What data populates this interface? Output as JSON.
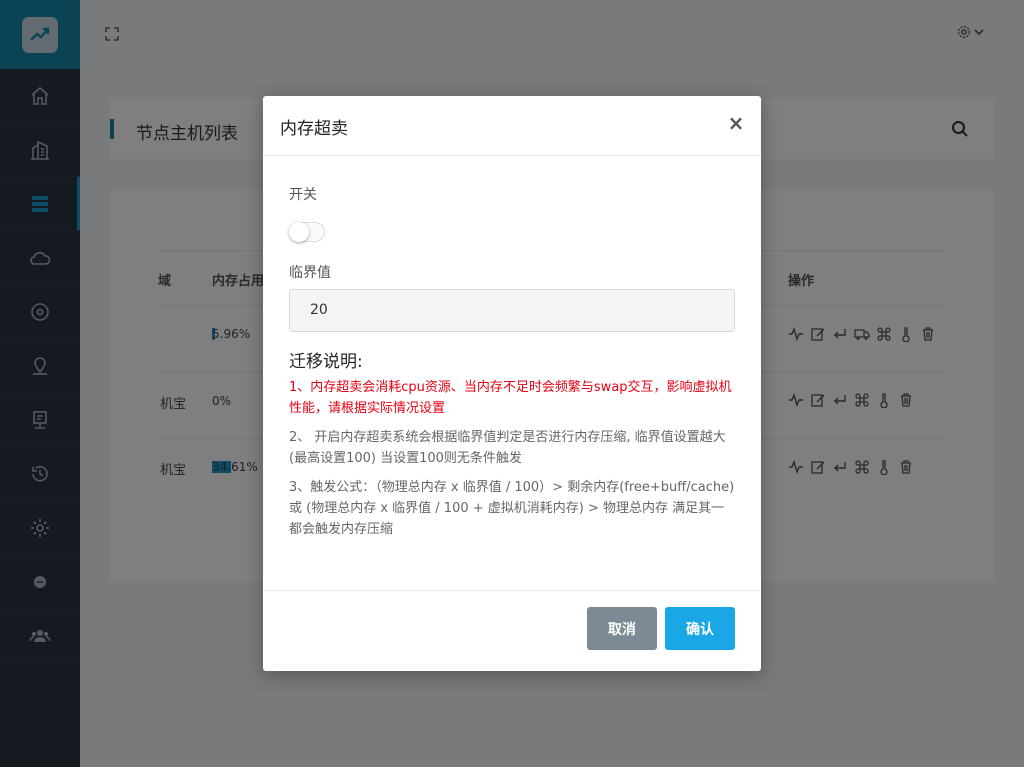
{
  "sidebar": {
    "items": [
      {
        "icon": "home-icon"
      },
      {
        "icon": "building-icon"
      },
      {
        "icon": "server-list-icon"
      },
      {
        "icon": "cloud-icon"
      },
      {
        "icon": "disk-icon"
      },
      {
        "icon": "map-pin-icon"
      },
      {
        "icon": "monitor-icon"
      },
      {
        "icon": "history-icon"
      },
      {
        "icon": "gear-icon"
      },
      {
        "icon": "badge-icon"
      },
      {
        "icon": "users-icon"
      }
    ],
    "active_index": 2
  },
  "page": {
    "title": "节点主机列表"
  },
  "table": {
    "headers": {
      "col1": "域",
      "col2": "内存占用",
      "col3": "操作"
    },
    "rows": [
      {
        "name": "",
        "mem": "5.96%",
        "mem_fraction": 0.06
      },
      {
        "name": "机宝",
        "mem": "0%",
        "mem_fraction": 0
      },
      {
        "name": "机宝",
        "mem": "34.61%",
        "mem_fraction": 0.35
      }
    ]
  },
  "modal": {
    "title": "内存超卖",
    "close_label": "×",
    "switch_label": "开关",
    "switch_on": false,
    "threshold_label": "临界值",
    "threshold_value": "20",
    "section_title": "迁移说明:",
    "note1": "1、内存超卖会消耗cpu资源、当内存不足时会频繁与swap交互，影响虚拟机性能，请根据实际情况设置",
    "note2": "2、 开启内存超卖系统会根据临界值判定是否进行内存压缩, 临界值设置越大(最高设置100) 当设置100则无条件触发",
    "note3": "3、触发公式：（物理总内存 x 临界值 / 100）> 剩余内存(free+buff/cache) 或 (物理总内存 x 临界值 / 100 + 虚拟机消耗内存) > 物理总内存 满足其一都会触发内存压缩",
    "cancel_label": "取消",
    "confirm_label": "确认"
  },
  "colors": {
    "sidebar_bg": "#2a3542",
    "brand": "#1589a8",
    "confirm": "#1aa7e6",
    "cancel": "#7b8a93",
    "warning_text": "#e60012"
  }
}
